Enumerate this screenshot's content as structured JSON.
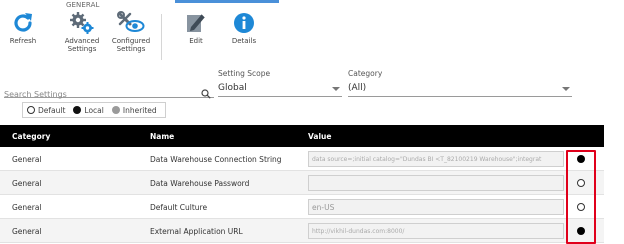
{
  "ribbon": {
    "group_label": "GENERAL",
    "buttons": [
      {
        "label": "Refresh",
        "icon": "refresh-icon"
      },
      {
        "label": "Advanced\nSettings",
        "icon": "gears-icon"
      },
      {
        "label": "Configured\nSettings",
        "icon": "wrench-eye-icon"
      },
      {
        "label": "Edit",
        "icon": "edit-icon"
      },
      {
        "label": "Details",
        "icon": "info-icon"
      }
    ]
  },
  "filters": {
    "search_placeholder": "Search Settings",
    "scope_label": "Setting Scope",
    "scope_value": "Global",
    "category_label": "Category",
    "category_value": "(All)"
  },
  "legend": {
    "default": "Default",
    "local": "Local",
    "inherited": "Inherited"
  },
  "table": {
    "headers": {
      "category": "Category",
      "name": "Name",
      "value": "Value"
    },
    "rows": [
      {
        "category": "General",
        "name": "Data Warehouse Connection String",
        "value": "data source=;initial catalog=\"Dundas BI <T_82100219 Warehouse\";integrat",
        "state": "local"
      },
      {
        "category": "General",
        "name": "Data Warehouse Password",
        "value": "",
        "state": "default"
      },
      {
        "category": "General",
        "name": "Default Culture",
        "value": "en-US",
        "state": "default"
      },
      {
        "category": "General",
        "name": "External Application URL",
        "value": "http://vikhil-dundas.com:8000/",
        "state": "local"
      }
    ]
  },
  "colors": {
    "accent": "#1e88d6",
    "header_bg": "#000000",
    "highlight": "#e0001b"
  }
}
